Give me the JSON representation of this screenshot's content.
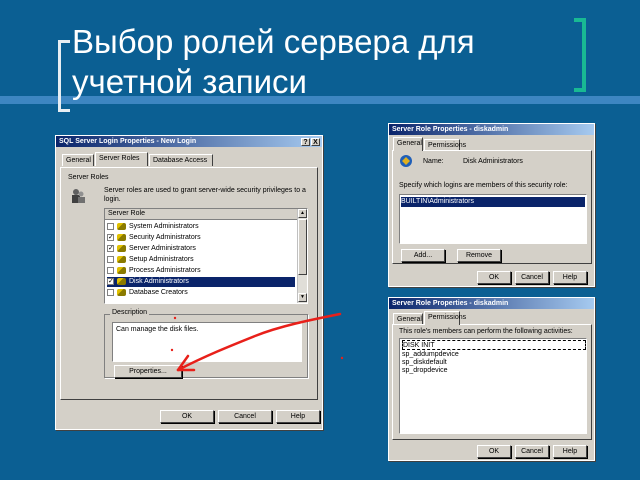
{
  "slide": {
    "title": "Выбор ролей сервера для учетной записи"
  },
  "login_dialog": {
    "title": "SQL Server Login Properties - New Login",
    "close_label": "X",
    "help_label": "?",
    "tabs": [
      "General",
      "Server Roles",
      "Database Access"
    ],
    "server_roles_group": "Server Roles",
    "description_text": "Server roles are used to grant server-wide security privileges to a login.",
    "list_header": "Server Role",
    "roles": [
      {
        "label": "System Administrators",
        "checked": false
      },
      {
        "label": "Security Administrators",
        "checked": true
      },
      {
        "label": "Server Administrators",
        "checked": true
      },
      {
        "label": "Setup Administrators",
        "checked": false
      },
      {
        "label": "Process Administrators",
        "checked": false
      },
      {
        "label": "Disk Administrators",
        "checked": true,
        "selected": true
      },
      {
        "label": "Database Creators",
        "checked": false
      }
    ],
    "description_group": "Description",
    "role_description": "Can manage the disk files.",
    "properties_button": "Properties...",
    "ok_button": "OK",
    "cancel_button": "Cancel",
    "help_button": "Help"
  },
  "role_props_general": {
    "title": "Server Role Properties - diskadmin",
    "tabs": [
      "General",
      "Permissions"
    ],
    "name_label": "Name:",
    "name_value": "Disk Administrators",
    "members_label": "Specify which logins are members of this security role:",
    "members": [
      "BUILTIN\\Administrators"
    ],
    "add_button": "Add...",
    "remove_button": "Remove",
    "ok_button": "OK",
    "cancel_button": "Cancel",
    "help_button": "Help"
  },
  "role_props_permissions": {
    "title": "Server Role Properties - diskadmin",
    "tabs": [
      "General",
      "Permissions"
    ],
    "perm_label": "This role's members can perform the following activities:",
    "permissions": [
      "DISK INIT",
      "sp_addumpdevice",
      "sp_diskdefault",
      "sp_dropdevice"
    ],
    "ok_button": "OK",
    "cancel_button": "Cancel",
    "help_button": "Help"
  },
  "colors": {
    "background": "#0b5f93",
    "annotation_arrow": "#e8201a",
    "selection": "#0a246a"
  }
}
